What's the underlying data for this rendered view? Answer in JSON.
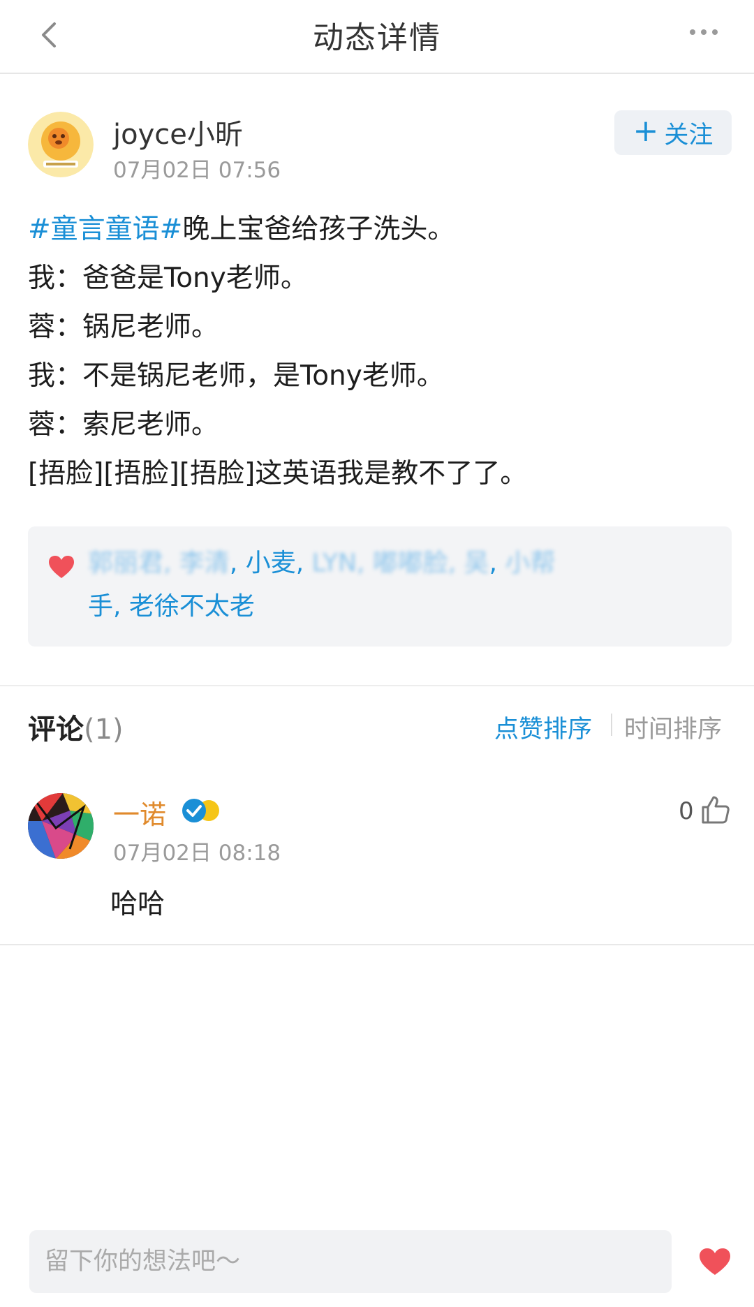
{
  "header": {
    "title": "动态详情",
    "back_icon": "chevron-left-icon",
    "more_icon": "more-dots-icon"
  },
  "post": {
    "author": "joyce小昕",
    "time": "07月02日 07:56",
    "follow_label": "关注",
    "follow_icon": "plus-icon",
    "topic": "#童言童语#",
    "lines": [
      "晚上宝爸给孩子洗头。",
      "我：爸爸是Tony老师。",
      "蓉：锅尼老师。",
      "我：不是锅尼老师，是Tony老师。",
      "蓉：索尼老师。",
      "[捂脸][捂脸][捂脸]这英语我是教不了了。"
    ],
    "likes": {
      "icon": "heart-icon",
      "names_blurred": "郭丽君, 李清",
      "names_visible_1": ", 小麦, ",
      "names_blurred_2": "LYN, 嘟嘟脸, 吴",
      "names_tail_blur": "小帮",
      "names_line2": "手, 老徐不太老"
    }
  },
  "comments": {
    "title": "评论",
    "count": "(1)",
    "sort_like": "点赞排序",
    "sort_time": "时间排序",
    "items": [
      {
        "name": "一诺",
        "time": "07月02日 08:18",
        "likes": "0",
        "text": "哈哈"
      }
    ]
  },
  "footer": {
    "input_placeholder": "留下你的想法吧～",
    "heart_icon": "heart-icon"
  },
  "colors": {
    "accent_blue": "#1a8fd6",
    "name_orange": "#e08a2c",
    "heart_red": "#f0515a"
  }
}
